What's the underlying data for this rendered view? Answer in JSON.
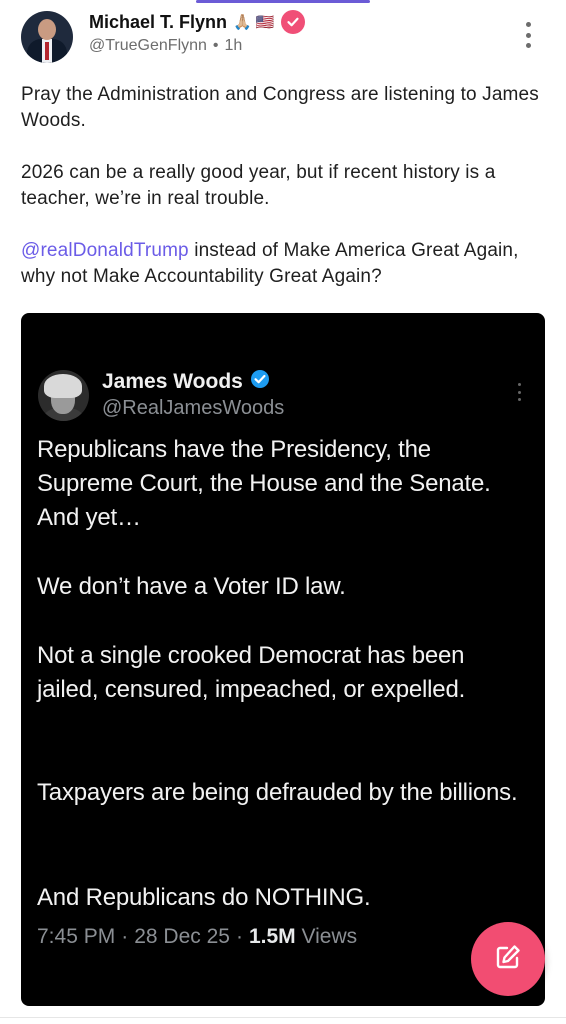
{
  "post": {
    "author_name": "Michael T. Flynn",
    "author_emojis": "🙏🏼 🇺🇸",
    "handle": "@TrueGenFlynn",
    "separator": "•",
    "time": "1h",
    "paragraph1": "Pray the Administration and Congress are listening to James Woods.",
    "paragraph2": "2026 can be a really good year, but if recent history is a teacher, we’re in real trouble.",
    "mention": "@realDonaldTrump",
    "paragraph3_rest": " instead of Make America Great Again, why not Make Accountability Great Again?"
  },
  "embedded_tweet": {
    "author_name": "James Woods",
    "handle": "@RealJamesWoods",
    "paragraphs": [
      "Republicans have the Presidency, the Supreme Court, the House and the Senate. And yet…",
      "We don’t have a Voter ID law.",
      "Not a single crooked Democrat has been jailed, censured, impeached, or expelled.",
      "Taxpayers are being defrauded by the billions.",
      "And Republicans do NOTHING."
    ],
    "time": "7:45 PM",
    "dot1": "·",
    "date": "28 Dec 25",
    "dot2": "·",
    "views_count": "1.5M",
    "views_label": "Views"
  },
  "colors": {
    "accent": "#6b5ce7",
    "badge": "#f04f77",
    "fab": "#f24d72",
    "verified_blue": "#1d9bf0"
  },
  "icons": {
    "verified": "verified-check-icon",
    "more": "more-vertical-icon",
    "compose": "compose-edit-icon"
  }
}
